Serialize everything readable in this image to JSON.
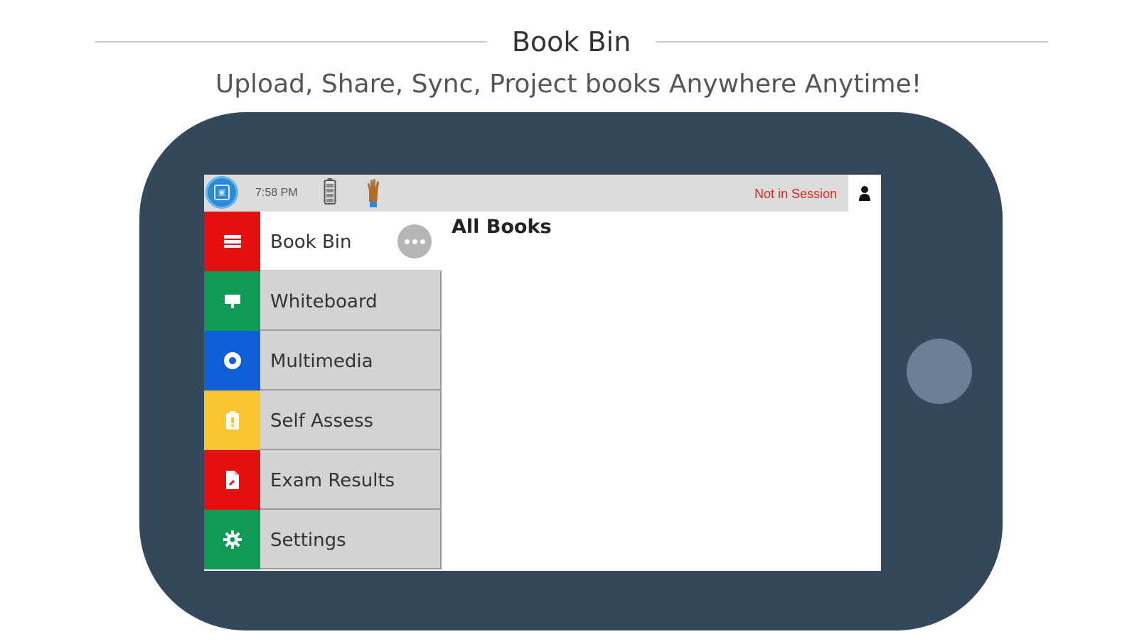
{
  "header": {
    "title": "Book Bin",
    "subtitle": "Upload, Share, Sync, Project books Anywhere Anytime!"
  },
  "device": {
    "frame_color": "#35475b",
    "home_button_color": "#6b7f96"
  },
  "statusbar": {
    "app_icon": "app-logo-icon",
    "time": "7:58 PM",
    "battery_icon": "battery-icon",
    "hand_icon": "raise-hand-icon",
    "session_status": "Not in Session",
    "session_status_color": "#e02424",
    "profile_icon": "user-icon"
  },
  "sidebar": {
    "items": [
      {
        "label": "Book Bin",
        "icon": "book-icon",
        "color": "#e60f0f",
        "active": true
      },
      {
        "label": "Whiteboard",
        "icon": "whiteboard-icon",
        "color": "#0f9a55",
        "active": false
      },
      {
        "label": "Multimedia",
        "icon": "multimedia-icon",
        "color": "#0e5fd8",
        "active": false
      },
      {
        "label": "Self Assess",
        "icon": "self-assess-icon",
        "color": "#f7c52d",
        "active": false
      },
      {
        "label": "Exam Results",
        "icon": "exam-results-icon",
        "color": "#e60f0f",
        "active": false
      },
      {
        "label": "Settings",
        "icon": "gear-icon",
        "color": "#0f9a55",
        "active": false
      }
    ],
    "more_icon": "more-options-icon"
  },
  "content": {
    "title": "All Books"
  }
}
